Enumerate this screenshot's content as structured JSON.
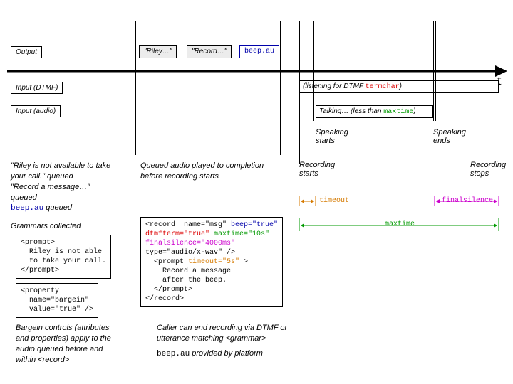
{
  "rowLabels": {
    "output": "Output",
    "inputDtmf": "Input (DTMF)",
    "inputAudio": "Input (audio)"
  },
  "chips": {
    "riley": "\"Riley…\"",
    "record": "\"Record…\"",
    "beep": "beep.au"
  },
  "barDtmf": {
    "prefix": "(listening for DTMF ",
    "term": "termchar",
    "suffix": ")"
  },
  "barAudio": {
    "prefix": "Talking…  (less than ",
    "maxtime": "maxtime",
    "suffix": ")"
  },
  "events": {
    "speakingStarts": "Speaking starts",
    "speakingEnds": "Speaking ends",
    "recordingStarts": "Recording starts",
    "recordingStops": "Recording stops"
  },
  "timeAxisLabel": "t",
  "leftNotes": {
    "l1": "\"Riley is not available to take",
    "l2": "your call.\"  queued",
    "l3": "\"Record a message…\"",
    "l4": "queued",
    "l5a": "beep.au",
    "l5b": " queued",
    "grammars": "Grammars collected"
  },
  "midNote": {
    "l1": "Queued audio played to completion",
    "l2": "before recording starts"
  },
  "codePrompt": "<prompt>\n  Riley is not able\n  to take your call.\n</prompt>",
  "codeProperty": "<property\n  name=\"bargein\"\n  value=\"true\" />",
  "codeRecord": {
    "open": "<record  name=\"msg\" ",
    "beepAttr": "beep=\"true\"",
    "dtmfAttr": "dtmfterm=\"true\"",
    "maxAttr": "maxtime=\"10s\"",
    "finalAttr": "finalsilence=\"4000ms\"",
    "typeLine": "type=\"audio/x-wav\" />",
    "pOpen": "  <prompt ",
    "timeoutAttr": "timeout=\"5s\"",
    "pOpenEnd": " >",
    "pBody": "    Record a message\n    after the beep.",
    "pClose": "  </prompt>",
    "close": "</record>"
  },
  "spans": {
    "timeout": "timeout",
    "finalsilence": "finalsilence",
    "maxtime": "maxtime"
  },
  "bottomLeft": {
    "l1": "Bargein controls (attributes",
    "l2": "and properties) apply to the",
    "l3": "audio queued before and",
    "l4": "within <record>"
  },
  "bottomRight": {
    "l1": "Caller can end recording via DTMF or",
    "l2": "utterance matching <grammar>",
    "l3a": "beep.au",
    "l3b": "  provided by platform"
  }
}
